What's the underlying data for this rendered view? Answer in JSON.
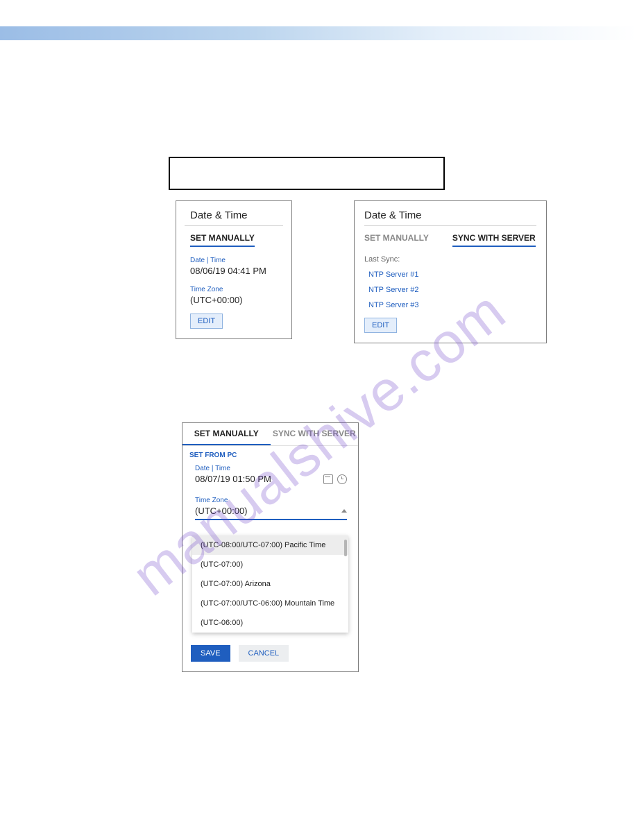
{
  "watermark": "manualshive.com",
  "card1": {
    "title": "Date & Time",
    "tab": "SET MANUALLY",
    "dt_label": "Date | Time",
    "dt_value": "08/06/19 04:41 PM",
    "tz_label": "Time Zone",
    "tz_value": "(UTC+00:00)",
    "edit": "EDIT"
  },
  "card2": {
    "title": "Date & Time",
    "tab_manual": "SET MANUALLY",
    "tab_sync": "SYNC WITH SERVER",
    "last_sync": "Last Sync:",
    "servers": [
      "NTP Server #1",
      "NTP Server #2",
      "NTP Server #3"
    ],
    "edit": "EDIT"
  },
  "card3": {
    "tab_manual": "SET MANUALLY",
    "tab_sync": "SYNC WITH SERVER",
    "set_from_pc": "SET FROM PC",
    "dt_label": "Date | Time",
    "dt_value": "08/07/19 01:50 PM",
    "tz_label": "Time Zone",
    "tz_value": "(UTC+00:00)",
    "options": [
      "(UTC-08:00/UTC-07:00) Pacific Time",
      "(UTC-07:00)",
      "(UTC-07:00) Arizona",
      "(UTC-07:00/UTC-06:00) Mountain Time",
      "(UTC-06:00)"
    ],
    "save": "SAVE",
    "cancel": "CANCEL"
  }
}
